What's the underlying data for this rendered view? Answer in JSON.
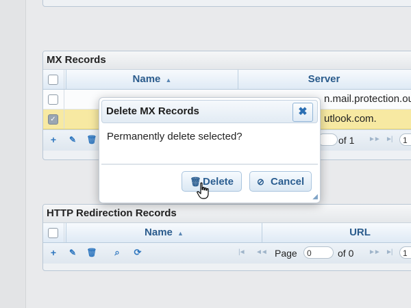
{
  "mx_panel": {
    "title": "MX Records",
    "columns": {
      "name": "Name",
      "server": "Server"
    },
    "rows": [
      {
        "server": "n.mail.protection.ou",
        "checked": false,
        "selected": false
      },
      {
        "server": "utlook.com.",
        "checked": true,
        "selected": true
      }
    ],
    "pager": {
      "of": "of 1",
      "page_value": "",
      "size_value": "1"
    }
  },
  "http_panel": {
    "title": "HTTP Redirection Records",
    "columns": {
      "name": "Name",
      "url": "URL"
    },
    "pager": {
      "page_label": "Page",
      "page_value": "0",
      "of": "of 0",
      "size_value": "1"
    }
  },
  "dialog": {
    "title": "Delete MX Records",
    "message": "Permanently delete selected?",
    "delete_label": "Delete",
    "cancel_label": "Cancel"
  },
  "icons": {
    "add": "plus-icon",
    "edit": "pencil-icon",
    "delete": "trash-icon",
    "search": "magnifier-icon",
    "refresh": "refresh-icon",
    "sort": "sort-icon",
    "close": "close-icon",
    "cancel": "ban-icon"
  },
  "colors": {
    "accent": "#2f77bf",
    "selected_row": "#f7e9a2",
    "header_text": "#2a5b8c"
  }
}
